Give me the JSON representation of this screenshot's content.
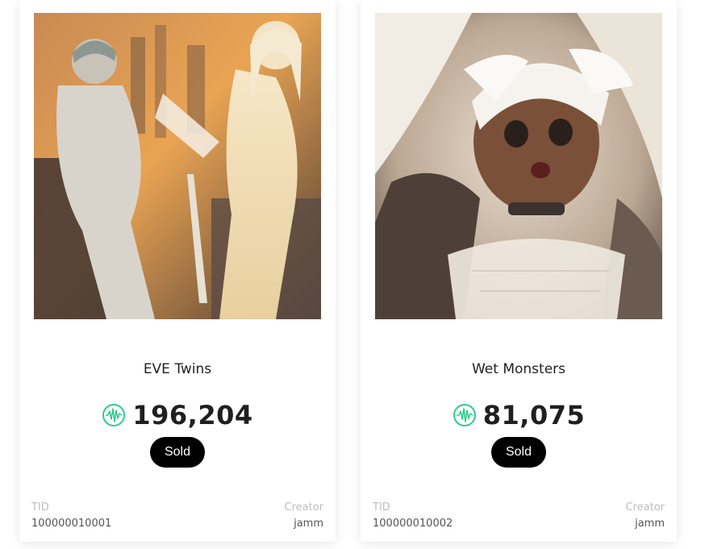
{
  "cards": [
    {
      "title": "EVE Twins",
      "price": "196,204",
      "status": "Sold",
      "tid_label": "TID",
      "tid": "100000010001",
      "creator_label": "Creator",
      "creator": "jamm"
    },
    {
      "title": "Wet Monsters",
      "price": "81,075",
      "status": "Sold",
      "tid_label": "TID",
      "tid": "100000010002",
      "creator_label": "Creator",
      "creator": "jamm"
    }
  ],
  "icons": {
    "currency": "waveform-coin-icon"
  },
  "colors": {
    "coin_accent": "#2ecc8f",
    "button_bg": "#000000",
    "button_text": "#ffffff",
    "meta_label": "#bdbdbd"
  }
}
